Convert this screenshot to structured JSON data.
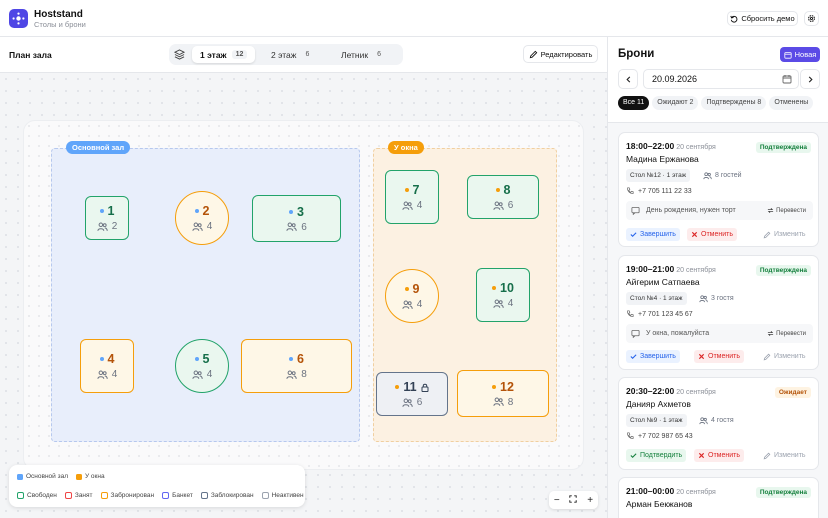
{
  "app": {
    "name": "Hoststand",
    "subtitle": "Столы и брони"
  },
  "header": {
    "reset_label": "Сбросить демо"
  },
  "toolbar": {
    "title": "План зала",
    "floors": [
      {
        "label": "1 этаж",
        "count": "12",
        "active": true
      },
      {
        "label": "2 этаж",
        "count": "6",
        "active": false
      },
      {
        "label": "Летник",
        "count": "6",
        "active": false
      }
    ],
    "edit_label": "Редактировать"
  },
  "zones": {
    "main": "Основной зал",
    "window": "У окна"
  },
  "tables": [
    {
      "num": "1",
      "seats": "2",
      "status": "free",
      "zone": "main"
    },
    {
      "num": "2",
      "seats": "4",
      "status": "booked",
      "zone": "main"
    },
    {
      "num": "3",
      "seats": "6",
      "status": "free",
      "zone": "main"
    },
    {
      "num": "4",
      "seats": "4",
      "status": "booked",
      "zone": "main"
    },
    {
      "num": "5",
      "seats": "4",
      "status": "free",
      "zone": "main"
    },
    {
      "num": "6",
      "seats": "8",
      "status": "booked",
      "zone": "main"
    },
    {
      "num": "7",
      "seats": "4",
      "status": "free",
      "zone": "window"
    },
    {
      "num": "8",
      "seats": "6",
      "status": "free",
      "zone": "window"
    },
    {
      "num": "9",
      "seats": "4",
      "status": "booked",
      "zone": "window"
    },
    {
      "num": "10",
      "seats": "4",
      "status": "free",
      "zone": "window"
    },
    {
      "num": "11",
      "seats": "6",
      "status": "blocked",
      "zone": "window"
    },
    {
      "num": "12",
      "seats": "8",
      "status": "booked",
      "zone": "window"
    }
  ],
  "legend": {
    "zones": [
      {
        "label": "Основной зал",
        "color": "#60a5fa"
      },
      {
        "label": "У окна",
        "color": "#f59e0b"
      }
    ],
    "statuses": [
      {
        "label": "Свободен",
        "color": "#22a36a"
      },
      {
        "label": "Занят",
        "color": "#ef4444"
      },
      {
        "label": "Забронирован",
        "color": "#f59e0b"
      },
      {
        "label": "Банкет",
        "color": "#6366f1"
      },
      {
        "label": "Заблокирован",
        "color": "#64748b"
      },
      {
        "label": "Неактивен",
        "color": "#9ca3af"
      }
    ]
  },
  "zoom": {
    "minus": "−",
    "plus": "+"
  },
  "panel": {
    "title": "Брони",
    "new_label": "Новая",
    "date": "20.09.2026",
    "filters": [
      {
        "label": "Все 11",
        "active": true
      },
      {
        "label": "Ожидают 2",
        "active": false
      },
      {
        "label": "Подтверждены 8",
        "active": false
      },
      {
        "label": "Отменены",
        "active": false
      }
    ],
    "bookings": [
      {
        "time": "18:00–22:00",
        "date": "20 сентября",
        "name": "Мадина Ержанова",
        "status": "Подтверждена",
        "status_type": "ok",
        "table": "Стол №12 · 1 этаж",
        "guests": "8 гостей",
        "phone": "+7 705 111 22 33",
        "note": "День рождения, нужен торт",
        "move": "Перевести",
        "primary": "Завершить",
        "cancel": "Отменить",
        "change": "Изменить"
      },
      {
        "time": "19:00–21:00",
        "date": "20 сентября",
        "name": "Айгерим Сатпаева",
        "status": "Подтверждена",
        "status_type": "ok",
        "table": "Стол №4 · 1 этаж",
        "guests": "3 гостя",
        "phone": "+7 701 123 45 67",
        "note": "У окна, пожалуйста",
        "move": "Перевести",
        "primary": "Завершить",
        "cancel": "Отменить",
        "change": "Изменить"
      },
      {
        "time": "20:30–22:00",
        "date": "20 сентября",
        "name": "Данияр Ахметов",
        "status": "Ожидает",
        "status_type": "wait",
        "table": "Стол №9 · 1 этаж",
        "guests": "4 гостя",
        "phone": "+7 702 987 65 43",
        "primary": "Подтвердить",
        "cancel": "Отменить",
        "change": "Изменить"
      },
      {
        "time": "21:00–00:00",
        "date": "20 сентября",
        "name": "Арман Бекжанов",
        "status": "Подтверждена",
        "status_type": "ok"
      }
    ]
  }
}
